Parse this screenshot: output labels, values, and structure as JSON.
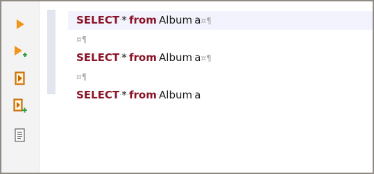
{
  "toolbar": {
    "items": [
      {
        "icon": "execute-statement-icon"
      },
      {
        "icon": "execute-in-new-tab-icon"
      },
      {
        "icon": "execute-script-icon"
      },
      {
        "icon": "execute-script-new-tab-icon"
      },
      {
        "icon": "explain-plan-icon"
      }
    ]
  },
  "colors": {
    "keyword": "#8a1428",
    "whitespace_marker": "#a9a9a9",
    "active_line": "#f2f3fc",
    "toolbar_bg": "#f3f3f3",
    "icon_orange": "#f0961c",
    "icon_green": "#2e9e3a"
  },
  "editor": {
    "lines": [
      {
        "kw1": "SELECT",
        "dot1": "·",
        "star": "*",
        "dot2": "·",
        "kw2": "from",
        "dot3": "·",
        "table": "Album",
        "dot4": "·",
        "alias": "a",
        "crlf": "¤",
        "pilcrow": "¶"
      },
      {
        "crlf": "¤",
        "pilcrow": "¶"
      },
      {
        "kw1": "SELECT",
        "dot1": "·",
        "star": "*",
        "dot2": "·",
        "kw2": "from",
        "dot3": "·",
        "table": "Album",
        "dot4": "·",
        "alias": "a",
        "crlf": "¤",
        "pilcrow": "¶"
      },
      {
        "crlf": "¤",
        "pilcrow": "¶"
      },
      {
        "kw1": "SELECT",
        "dot1": "·",
        "star": "*",
        "dot2": "·",
        "kw2": "from",
        "dot3": "·",
        "table": "Album",
        "dot4": "·",
        "alias": "a"
      }
    ]
  }
}
